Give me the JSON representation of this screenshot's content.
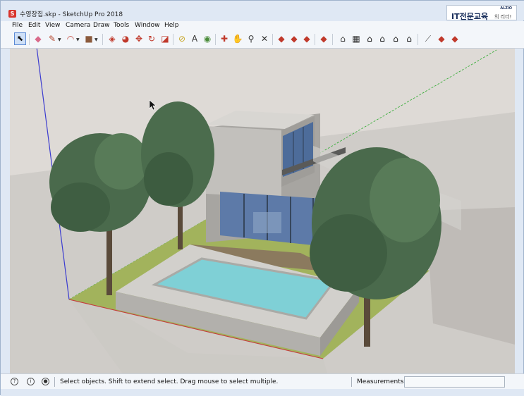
{
  "window": {
    "title": "수영장집.skp - SketchUp Pro 2018",
    "app_icon_glyph": "S"
  },
  "brand": {
    "small": "ALZIO",
    "main": "IT전문교육",
    "sub": "의 리더!"
  },
  "menu": {
    "items": [
      "File",
      "Edit",
      "View",
      "Camera",
      "Draw",
      "Tools",
      "Window",
      "Help"
    ]
  },
  "toolbar": {
    "tools": [
      {
        "name": "select-tool",
        "icon": "arrow-cursor-icon",
        "glyph": "⬉",
        "color": "#111111"
      },
      {
        "name": "eraser-tool",
        "icon": "eraser-icon",
        "glyph": "◆",
        "color": "#d96a8a"
      },
      {
        "name": "line-tool",
        "icon": "pencil-icon",
        "glyph": "✎",
        "color": "#b5462c"
      },
      {
        "name": "arc-tool",
        "icon": "arc-icon",
        "glyph": "◠",
        "color": "#c0392b"
      },
      {
        "name": "rectangle-tool",
        "icon": "rectangle-icon",
        "glyph": "■",
        "color": "#8b5a3c"
      },
      {
        "name": "push-pull-tool",
        "icon": "push-pull-icon",
        "glyph": "◈",
        "color": "#c0392b"
      },
      {
        "name": "follow-me-tool",
        "icon": "follow-me-icon",
        "glyph": "◕",
        "color": "#c0392b"
      },
      {
        "name": "move-tool",
        "icon": "move-icon",
        "glyph": "✥",
        "color": "#c0392b"
      },
      {
        "name": "rotate-tool",
        "icon": "rotate-icon",
        "glyph": "↻",
        "color": "#c0392b"
      },
      {
        "name": "scale-tool",
        "icon": "scale-icon",
        "glyph": "◪",
        "color": "#c0392b"
      },
      {
        "name": "tape-measure-tool",
        "icon": "tape-measure-icon",
        "glyph": "⊘",
        "color": "#c9a82c"
      },
      {
        "name": "text-tool",
        "icon": "text-icon",
        "glyph": "A",
        "color": "#333333"
      },
      {
        "name": "paint-bucket-tool",
        "icon": "paint-bucket-icon",
        "glyph": "◉",
        "color": "#4a8c3a"
      },
      {
        "name": "orbit-tool",
        "icon": "orbit-icon",
        "glyph": "✚",
        "color": "#c0392b"
      },
      {
        "name": "pan-tool",
        "icon": "hand-icon",
        "glyph": "✋",
        "color": "#c9a82c"
      },
      {
        "name": "zoom-tool",
        "icon": "magnifier-icon",
        "glyph": "⚲",
        "color": "#333333"
      },
      {
        "name": "zoom-extents-tool",
        "icon": "zoom-extents-icon",
        "glyph": "✕",
        "color": "#333333"
      },
      {
        "name": "warehouse-button",
        "icon": "warehouse-icon",
        "glyph": "◆",
        "color": "#c0392b"
      },
      {
        "name": "share-model-button",
        "icon": "share-model-icon",
        "glyph": "◆",
        "color": "#c0392b"
      },
      {
        "name": "extension-warehouse-button",
        "icon": "extension-warehouse-icon",
        "glyph": "◆",
        "color": "#c0392b"
      },
      {
        "name": "layout-button",
        "icon": "layout-icon",
        "glyph": "◆",
        "color": "#c0392b"
      },
      {
        "name": "iso-view-button",
        "icon": "iso-house-icon",
        "glyph": "⌂",
        "color": "#333333"
      },
      {
        "name": "top-view-button",
        "icon": "top-house-icon",
        "glyph": "▦",
        "color": "#333333"
      },
      {
        "name": "front-view-button",
        "icon": "front-house-icon",
        "glyph": "⌂",
        "color": "#111111"
      },
      {
        "name": "right-view-button",
        "icon": "right-house-icon",
        "glyph": "⌂",
        "color": "#111111"
      },
      {
        "name": "back-view-button",
        "icon": "back-house-icon",
        "glyph": "⌂",
        "color": "#111111"
      },
      {
        "name": "left-view-button",
        "icon": "left-house-icon",
        "glyph": "⌂",
        "color": "#111111"
      },
      {
        "name": "section-plane-button",
        "icon": "section-plane-icon",
        "glyph": "⟋",
        "color": "#555555"
      },
      {
        "name": "components-button",
        "icon": "components-icon",
        "glyph": "◆",
        "color": "#c0392b"
      },
      {
        "name": "styles-button",
        "icon": "styles-icon",
        "glyph": "◆",
        "color": "#c0392b"
      }
    ]
  },
  "status": {
    "text": "Select objects. Shift to extend select. Drag mouse to select multiple.",
    "measurements_label": "Measurements",
    "measurements_value": ""
  },
  "colors": {
    "sky": "#dedad6",
    "ground": "#cfccc8",
    "lawn": "#a2b35c",
    "pool_water": "#7fd0d6",
    "pool_coping": "#c9c7c3",
    "house_wall": "#bdbbb7",
    "glass": "#5d7aa8",
    "tree_foliage": "#4a6a4c",
    "trunk": "#5a4a3a",
    "axis_red": "#c43c3c",
    "axis_green": "#3cae3c",
    "axis_blue": "#3c3cd0"
  }
}
